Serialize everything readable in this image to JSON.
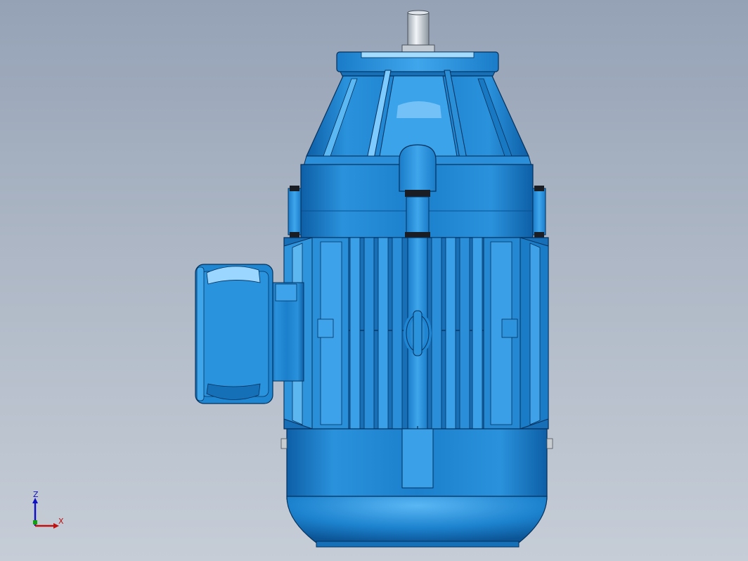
{
  "viewport": {
    "background_top": "#95a2b6",
    "background_bottom": "#c6cdd7"
  },
  "model": {
    "name": "motor-3d-model",
    "body_color": "#1e86d2",
    "highlight_color": "#8fd2ff",
    "shadow_color": "#0a4f8f",
    "edge_color": "#06305a"
  },
  "triad": {
    "z_label": "Z",
    "x_label": "X",
    "z_color": "#1010c0",
    "x_color": "#c01010",
    "y_color": "#10a010"
  }
}
